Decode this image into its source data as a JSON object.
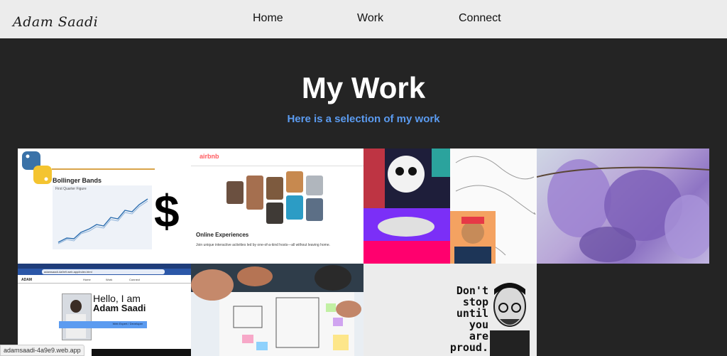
{
  "nav": {
    "logo": "Adam Saadi",
    "links": [
      "Home",
      "Work",
      "Connect"
    ]
  },
  "hero": {
    "title": "My Work",
    "subtitle": "Here is a selection of my work"
  },
  "gallery": {
    "bollinger": {
      "title": "Bollinger Bands",
      "subtitle": "First Quarter Figure",
      "symbol": "$"
    },
    "airbnb": {
      "brand": "airbnb",
      "heading": "Online Experiences",
      "body": "Join unique interactive activities led by one-of-a-kind hosts—all without leaving home."
    },
    "portfolio": {
      "url": "adamsaadi-4a9e9.web.app/index.html",
      "brand": "ADAM",
      "nav": [
        "Home",
        "Work",
        "Connect"
      ],
      "greeting": "Hello, I am",
      "name": "Adam Saadi",
      "tags": "Web Expert  /  Developer"
    },
    "poster": {
      "text": "Don't stop until you are proud."
    }
  },
  "status_url": "adamsaadi-4a9e9.web.app",
  "colors": {
    "accent": "#5b9bf0",
    "nav_bg": "#ececec",
    "page_bg": "#242424"
  }
}
